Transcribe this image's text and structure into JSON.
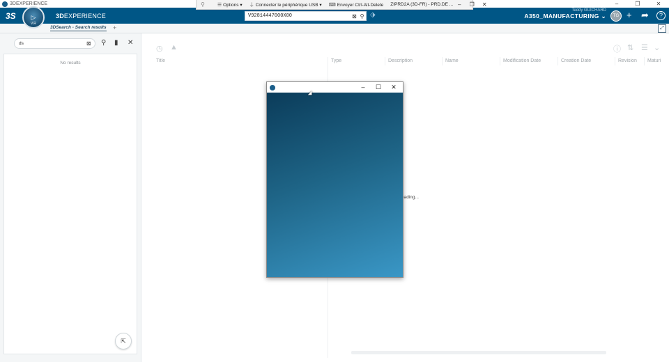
{
  "os_window": {
    "title": "3DEXPERIENCE",
    "controls": [
      "–",
      "❐",
      "✕"
    ]
  },
  "rdp_toolbar": {
    "options_label": "Options",
    "usb_label": "Connecter le périphérique USB",
    "ctrl_alt_del_label": "Envoyer Ctrl-Alt-Delete",
    "session_label": "ZIPRD2A (3D-FR) - PRD.DE ...",
    "controls": [
      "–",
      "❐",
      "✕"
    ]
  },
  "topbar": {
    "logo": "3S",
    "brand_prefix": "3D",
    "brand_suffix": "EXPERIENCE",
    "compass_version": "V.R",
    "search_value": "V92814447000X00",
    "user_name": "Teddy GUICHARD",
    "tenant": "A350_MANUFACTURING ⌄",
    "avatar_initials": "TG",
    "icons": {
      "add": "+",
      "share": "➦",
      "help": "?"
    }
  },
  "tabbar": {
    "tab_label": "3DSearch - Search results",
    "add_label": "+"
  },
  "left_panel": {
    "filter_value": "ds",
    "no_results": "No results"
  },
  "right_panel": {
    "columns": [
      "Title",
      "Type",
      "Description",
      "Name",
      "Modification Date",
      "Creation Date",
      "Revision",
      "Maturi"
    ],
    "loading_text": "oading..."
  },
  "colors": {
    "topbar_bg": "#005686",
    "popup_gradient_start": "#0b3c5a",
    "popup_gradient_end": "#3a97c6"
  }
}
